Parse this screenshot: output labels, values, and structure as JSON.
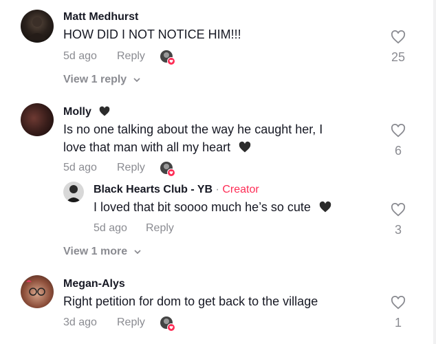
{
  "comments": [
    {
      "username": "Matt Medhurst",
      "text": "HOW DID I NOT NOTICE HIM!!!",
      "time": "5d ago",
      "reply_label": "Reply",
      "likes": "25",
      "view_replies": "View 1 reply"
    },
    {
      "username": "Molly",
      "text_line1": "Is no one talking about the way he caught her, I",
      "text_line2": "love that man with all my heart",
      "time": "5d ago",
      "reply_label": "Reply",
      "likes": "6",
      "reply": {
        "username": "Black Hearts Club - YB",
        "separator": "·",
        "badge": "Creator",
        "text": "I loved that bit soooo much he’s so cute",
        "time": "5d ago",
        "reply_label": "Reply",
        "likes": "3"
      },
      "view_more": "View 1 more"
    },
    {
      "username": "Megan-Alys",
      "text": "Right petition for dom to get back to the village",
      "time": "3d ago",
      "reply_label": "Reply",
      "likes": "1"
    }
  ],
  "colors": {
    "text": "#161823",
    "muted": "#8a8b91",
    "creator": "#fe2c55"
  }
}
